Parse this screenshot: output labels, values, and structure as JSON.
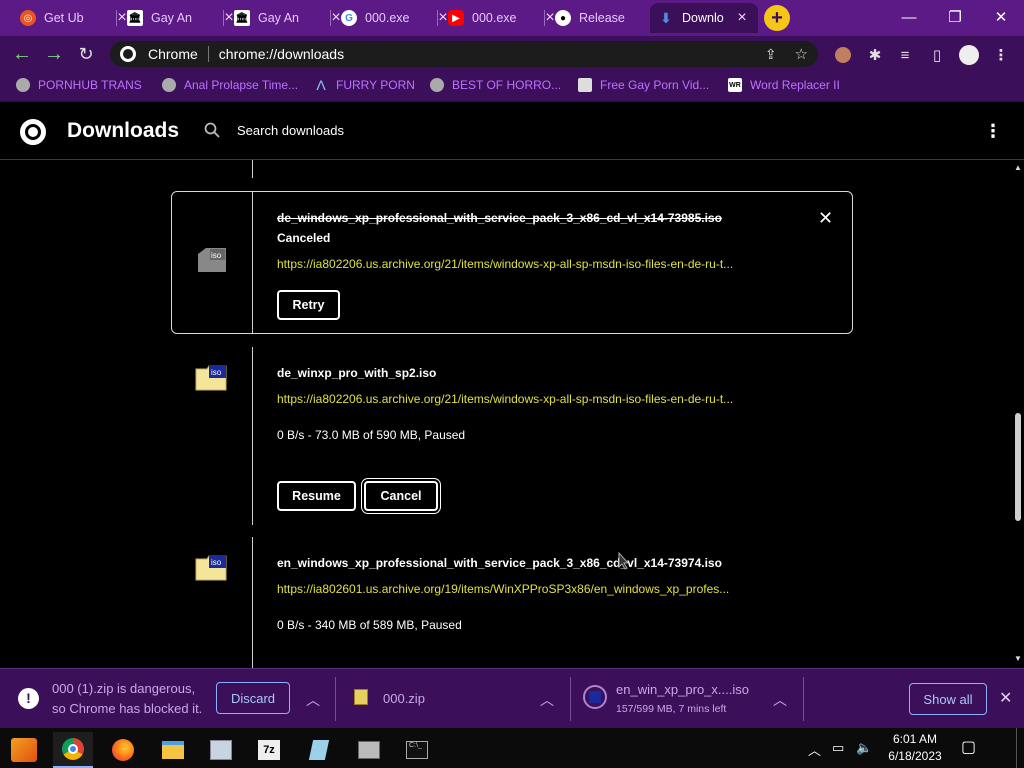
{
  "tabs": [
    {
      "title": "Get Ub",
      "icon": "ubuntu-icon",
      "color": "#e95420"
    },
    {
      "title": "Gay An",
      "icon": "archive-icon",
      "color": "#333333"
    },
    {
      "title": "Gay An",
      "icon": "archive-icon",
      "color": "#333333"
    },
    {
      "title": "000.exe",
      "icon": "google-icon",
      "color": "#4285f4"
    },
    {
      "title": "000.exe",
      "icon": "youtube-icon",
      "color": "#ff0000"
    },
    {
      "title": "Release",
      "icon": "github-icon",
      "color": "#222222"
    },
    {
      "title": "Downlo",
      "icon": "download-icon",
      "color": "#4a90e2"
    }
  ],
  "window": {
    "minimize": "—",
    "maximize": "❐",
    "close": "✕"
  },
  "omnibox": {
    "site_label": "Chrome",
    "url": "chrome://downloads"
  },
  "bookmarks": [
    {
      "label": "PORNHUB TRANS",
      "icon": "globe-icon"
    },
    {
      "label": "Anal Prolapse Time...",
      "icon": "globe-icon"
    },
    {
      "label": "FURRY PORN",
      "icon": "lambda-icon"
    },
    {
      "label": "BEST OF HORRO...",
      "icon": "globe-icon"
    },
    {
      "label": "Free Gay Porn Vid...",
      "icon": "robot-icon"
    },
    {
      "label": "Word Replacer II",
      "icon": "wr-icon"
    }
  ],
  "page": {
    "title": "Downloads",
    "search_placeholder": "Search downloads"
  },
  "downloads": [
    {
      "filename": "de_windows_xp_professional_with_service_pack_3_x86_cd_vl_x14-73985.iso",
      "status": "Canceled",
      "url": "https://ia802206.us.archive.org/21/items/windows-xp-all-sp-msdn-iso-files-en-de-ru-t...",
      "button": "Retry"
    },
    {
      "filename": "de_winxp_pro_with_sp2.iso",
      "url": "https://ia802206.us.archive.org/21/items/windows-xp-all-sp-msdn-iso-files-en-de-ru-t...",
      "status": "0 B/s - 73.0 MB of 590 MB, Paused",
      "button1": "Resume",
      "button2": "Cancel"
    },
    {
      "filename": "en_windows_xp_professional_with_service_pack_3_x86_cd_vl_x14-73974.iso",
      "url": "https://ia802601.us.archive.org/19/items/WinXPProSP3x86/en_windows_xp_profes...",
      "status": "0 B/s - 340 MB of 589 MB, Paused"
    }
  ],
  "shelf": {
    "warning_line1": "000 (1).zip is dangerous,",
    "warning_line2": "so Chrome has blocked it.",
    "discard": "Discard",
    "item2": "000.zip",
    "item3_name": "en_win_xp_pro_x....iso",
    "item3_status": "157/599 MB, 7 mins left",
    "show_all": "Show all"
  },
  "taskbar": {
    "time": "6:01 AM",
    "date": "6/18/2023",
    "apps": [
      "start-icon",
      "chrome-icon",
      "firefox-icon",
      "file-explorer-icon",
      "system-icon",
      "7zip-icon",
      "notepad-icon",
      "setup-icon",
      "cmd-icon"
    ]
  },
  "colors": {
    "tabstrip": "#5b1a86",
    "toolbar": "#3c0f5a",
    "url_text": "#e0e040",
    "bookmark_text": "#c070ff"
  }
}
